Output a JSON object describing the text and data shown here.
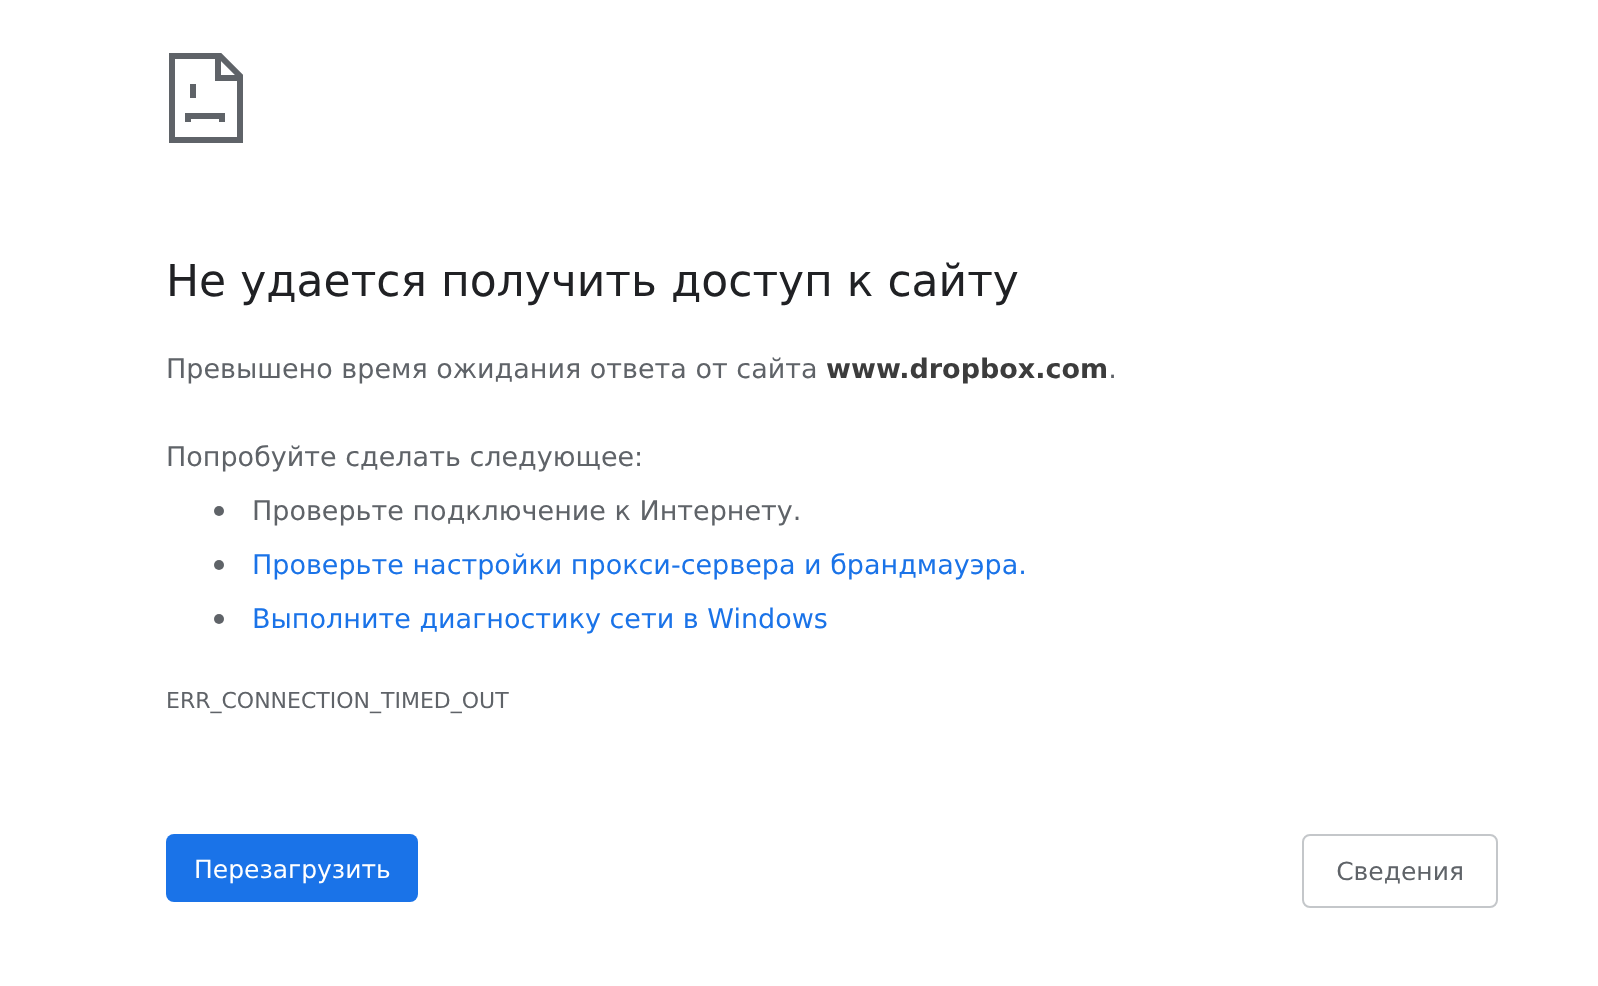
{
  "heading": "Не удается получить доступ к сайту",
  "summary": "Превышено время ожидания ответа от сайта **www.dropbox.com**.",
  "suggestions_title": "Попробуйте сделать следующее:",
  "suggestions": [
    {
      "kind": "text",
      "text": "Проверьте подключение к Интернету."
    },
    {
      "kind": "link",
      "text": "Проверьте настройки прокси-сервера и брандмауэра."
    },
    {
      "kind": "link",
      "text": "Выполните диагностику сети в Windows"
    }
  ],
  "error_code": "ERR_CONNECTION_TIMED_OUT",
  "buttons": [
    {
      "kind": "primary",
      "label": "Перезагрузить"
    },
    {
      "kind": "secondary",
      "label": "Сведения"
    }
  ]
}
